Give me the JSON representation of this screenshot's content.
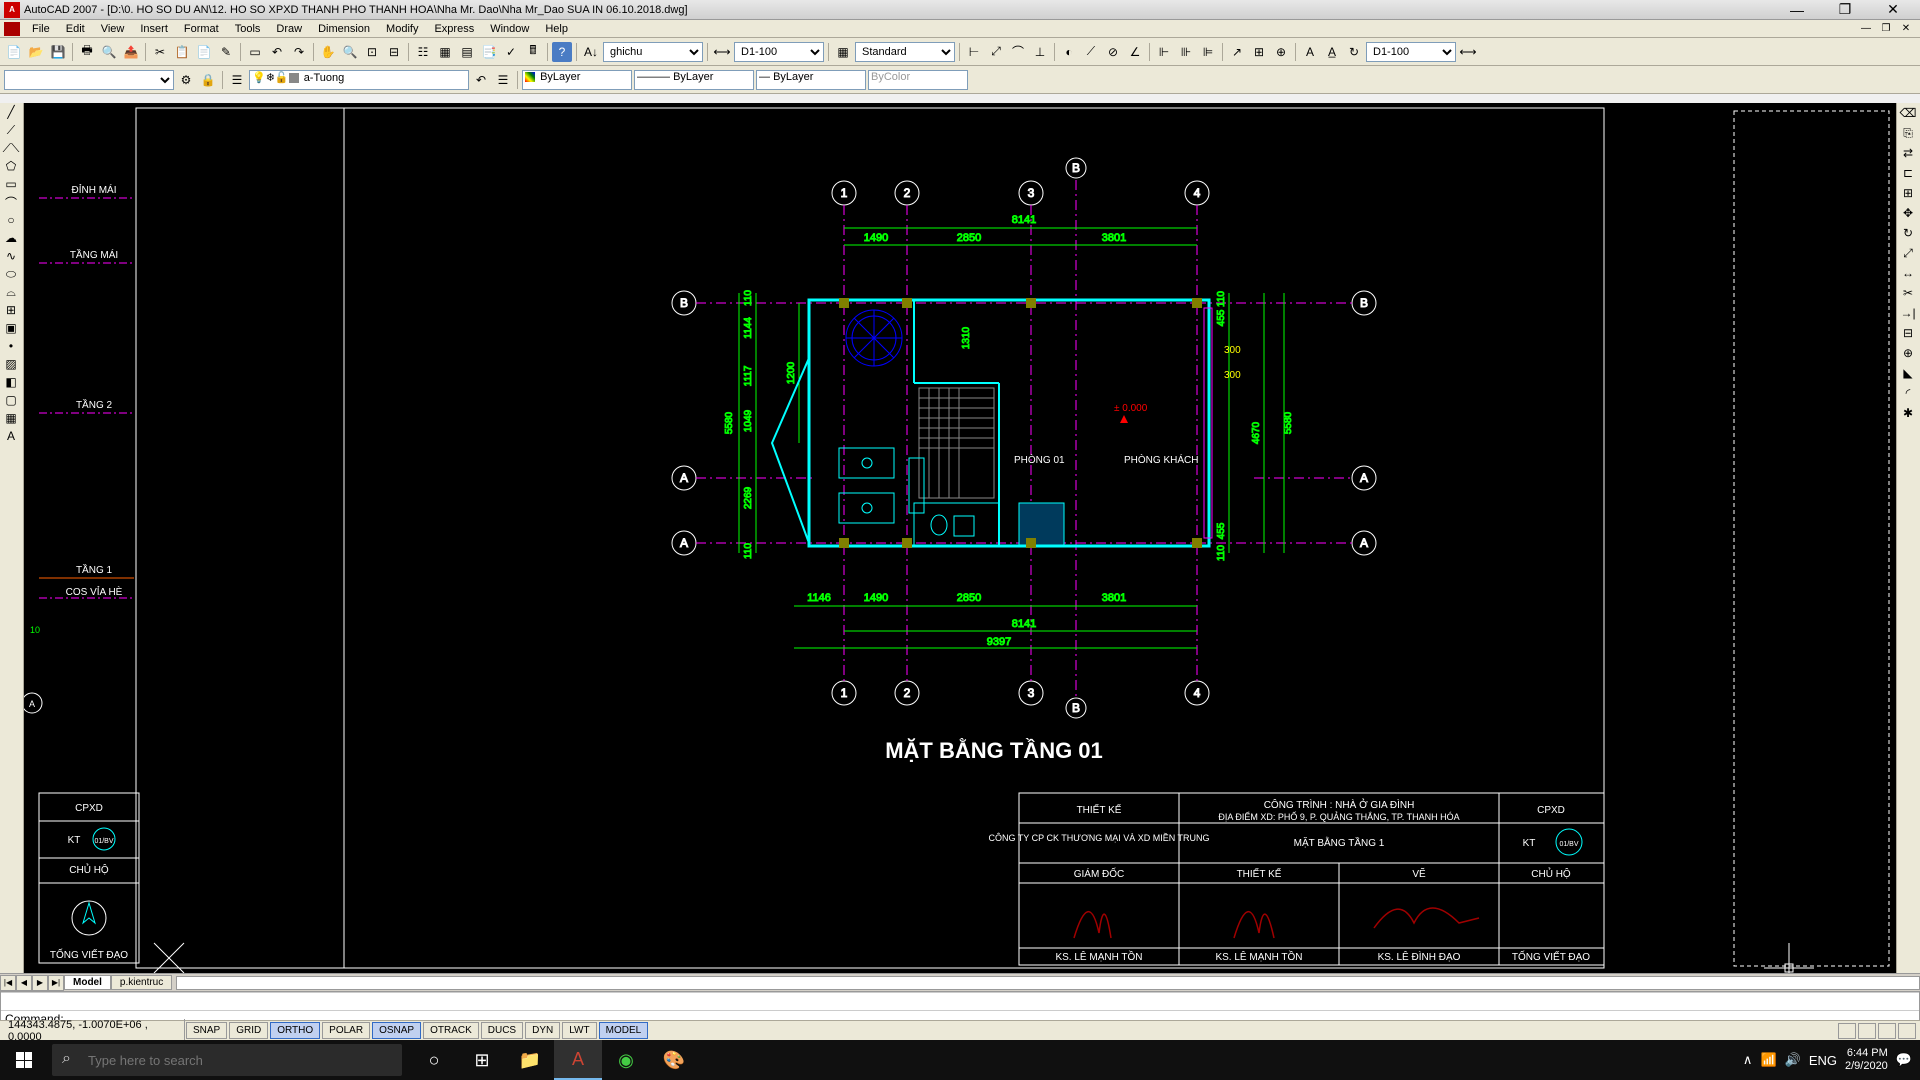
{
  "title": "AutoCAD 2007 - [D:\\0. HO SO DU AN\\12. HO SO XPXD THANH PHO THANH HOA\\Nha Mr. Dao\\Nha Mr_Dao SUA IN 06.10.2018.dwg]",
  "menu": [
    "File",
    "Edit",
    "View",
    "Insert",
    "Format",
    "Tools",
    "Draw",
    "Dimension",
    "Modify",
    "Express",
    "Window",
    "Help"
  ],
  "tb1_combos": {
    "style": "ghichu",
    "dim": "D1-100",
    "textstyle": "Standard",
    "dim2": "D1-100"
  },
  "tb2": {
    "layer": "a-Tuong",
    "color": "ByLayer",
    "linetype": "ByLayer",
    "lweight": "ByLayer",
    "plot": "ByColor"
  },
  "tabs": {
    "nav": [
      "|◀",
      "◀",
      "▶",
      "▶|"
    ],
    "items": [
      "Model",
      "p.kientruc"
    ],
    "active": 0
  },
  "command": {
    "prompt": "Command:",
    "input": ""
  },
  "status": {
    "coords": "144343.4875, -1.0070E+06 , 0.0000",
    "toggles": [
      "SNAP",
      "GRID",
      "ORTHO",
      "POLAR",
      "OSNAP",
      "OTRACK",
      "DUCS",
      "DYN",
      "LWT",
      "MODEL"
    ],
    "on": [
      "OSNAP",
      "MODEL",
      "ORTHO"
    ]
  },
  "taskbar": {
    "search_ph": "Type here to search",
    "lang": "ENG",
    "time": "6:44 PM",
    "date": "2/9/2020"
  },
  "drawing": {
    "levels": [
      "ĐỈNH MÁI",
      "TẦNG MÁI",
      "TẦNG 2",
      "TẦNG 1",
      "COS VỈA HÈ"
    ],
    "left_titleblock": {
      "h1": "CPXD",
      "kt": "KT",
      "chuho": "CHỦ HỘ",
      "owner": "TỐNG VIẾT ĐẠO"
    },
    "plan_title": "MẶT BẰNG TẦNG 01",
    "rooms": {
      "r1": "PHÒNG 01",
      "r2": "PHÒNG KHÁCH"
    },
    "elev": "± 0.000",
    "grids_v": [
      "1",
      "2",
      "3",
      "4"
    ],
    "grids_h": [
      "A",
      "B"
    ],
    "dims_top": {
      "overall": "8141",
      "d1": "1490",
      "d2": "2850",
      "d3": "3801"
    },
    "dims_bottom": {
      "overall": "8141",
      "alt": "9397",
      "d0": "1146",
      "d1": "1490",
      "d2": "2850",
      "d3": "3801"
    },
    "dims_left": {
      "overall": "5580",
      "a": "110",
      "b": "1144",
      "c": "1117",
      "d": "1049",
      "e": "2269",
      "f": "110",
      "g": "1310",
      "h": "1200"
    },
    "dims_right": {
      "overall": "5580",
      "a": "110",
      "b": "455",
      "c": "300",
      "d": "300",
      "e": "4670",
      "f": "455",
      "g": "110"
    },
    "titleblock": {
      "c1_head": "THIẾT KẾ",
      "c1_company": "CÔNG TY CP CK THƯƠNG MẠI VÀ XD MIỀN TRUNG",
      "c1_role": "GIÁM ĐỐC",
      "c1_name": "KS. LÊ MẠNH TỒN",
      "c2_project": "CÔNG TRÌNH : NHÀ Ở GIA ĐÌNH",
      "c2_addr": "ĐỊA ĐIỂM XD: PHỐ 9, P. QUẢNG THẮNG, TP. THANH HÓA",
      "c2_sheet": "MẶT BẰNG TẦNG 1",
      "c2_role1": "THIẾT KẾ",
      "c2_name1": "KS. LÊ MẠNH TỒN",
      "c2_role2": "VẼ",
      "c2_name2": "KS. LÊ ĐÌNH ĐẠO",
      "c3_head": "CPXD",
      "c3_kt": "KT",
      "c3_role": "CHỦ HỘ",
      "c3_name": "TỐNG VIẾT ĐẠO",
      "c3_sheet": "01/BV"
    }
  }
}
